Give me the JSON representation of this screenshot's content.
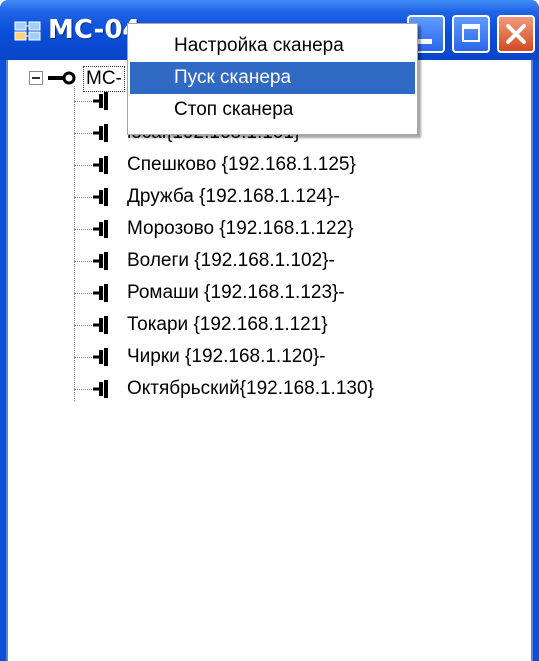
{
  "window": {
    "title": "MC-04",
    "buttons": {
      "minimize": "minimize",
      "maximize": "maximize",
      "close": "close"
    }
  },
  "tree": {
    "root": {
      "label": "MC-",
      "expander": "−"
    },
    "items": [
      {
        "label": ""
      },
      {
        "label": "local{192.168.1.101}-"
      },
      {
        "label": "Спешково  {192.168.1.125}"
      },
      {
        "label": "Дружба {192.168.1.124}-"
      },
      {
        "label": "Морозово {192.168.1.122}"
      },
      {
        "label": "Волеги {192.168.1.102}-"
      },
      {
        "label": "Ромаши {192.168.1.123}-"
      },
      {
        "label": "Токари {192.168.1.121}"
      },
      {
        "label": "Чирки {192.168.1.120}-"
      },
      {
        "label": "Октябрьский{192.168.1.130}"
      }
    ]
  },
  "context_menu": {
    "items": [
      {
        "label": "Настройка сканера",
        "selected": false
      },
      {
        "label": "Пуск сканера",
        "selected": true
      },
      {
        "label": "Стоп сканера",
        "selected": false
      }
    ]
  },
  "colors": {
    "titlebar": "#0a4ed8",
    "selection": "#316ac5",
    "close_button": "#d24a1f"
  },
  "icons": {
    "app": "network-monitor-icon",
    "root": "network-connector-icon",
    "node": "network-plug-icon"
  }
}
